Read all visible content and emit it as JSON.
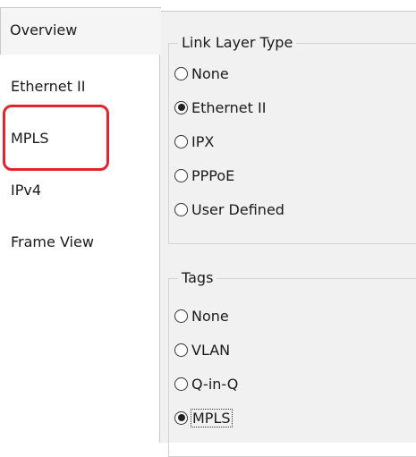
{
  "tabs": {
    "overview": "Overview",
    "ethernet": "Ethernet II",
    "mpls": "MPLS",
    "ipv4": "IPv4",
    "frame_view": "Frame View"
  },
  "link_layer": {
    "title": "Link Layer Type",
    "options": [
      "None",
      "Ethernet II",
      "IPX",
      "PPPoE",
      "User Defined"
    ],
    "selected": "Ethernet II"
  },
  "tags": {
    "title": "Tags",
    "options": [
      "None",
      "VLAN",
      "Q-in-Q",
      "MPLS"
    ],
    "selected": "MPLS"
  },
  "highlight_color": "#e3242b"
}
